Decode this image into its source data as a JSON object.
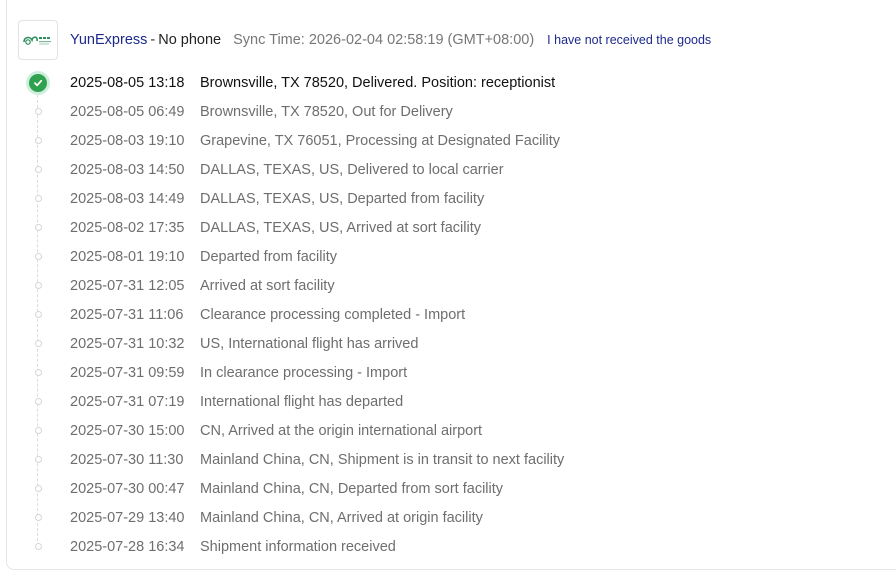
{
  "header": {
    "carrier_name": "YunExpress",
    "separator": "-",
    "phone": "No phone",
    "sync_time": "Sync Time: 2026-02-04 02:58:19 (GMT+08:00)",
    "not_received_link": "I have not received the goods",
    "logo_icon": "yunexpress-logo-icon",
    "accent_color": "#1d2a8c"
  },
  "events": [
    {
      "time": "2025-08-05 13:18",
      "description": "Brownsville, TX 78520, Delivered. Position: receptionist",
      "status": "delivered"
    },
    {
      "time": "2025-08-05 06:49",
      "description": "Brownsville, TX 78520, Out for Delivery"
    },
    {
      "time": "2025-08-03 19:10",
      "description": "Grapevine, TX 76051, Processing at Designated Facility"
    },
    {
      "time": "2025-08-03 14:50",
      "description": "DALLAS, TEXAS, US, Delivered to local carrier"
    },
    {
      "time": "2025-08-03 14:49",
      "description": "DALLAS, TEXAS, US, Departed from facility"
    },
    {
      "time": "2025-08-02 17:35",
      "description": "DALLAS, TEXAS, US, Arrived at sort facility"
    },
    {
      "time": "2025-08-01 19:10",
      "description": "Departed from facility"
    },
    {
      "time": "2025-07-31 12:05",
      "description": "Arrived at sort facility"
    },
    {
      "time": "2025-07-31 11:06",
      "description": "Clearance processing completed - Import"
    },
    {
      "time": "2025-07-31 10:32",
      "description": "US, International flight has arrived"
    },
    {
      "time": "2025-07-31 09:59",
      "description": "In clearance processing - Import"
    },
    {
      "time": "2025-07-31 07:19",
      "description": "International flight has departed"
    },
    {
      "time": "2025-07-30 15:00",
      "description": "CN, Arrived at the origin international airport"
    },
    {
      "time": "2025-07-30 11:30",
      "description": "Mainland China, CN, Shipment is in transit to next facility"
    },
    {
      "time": "2025-07-30 00:47",
      "description": "Mainland China, CN, Departed from sort facility"
    },
    {
      "time": "2025-07-29 13:40",
      "description": "Mainland China, CN, Arrived at origin facility"
    },
    {
      "time": "2025-07-28 16:34",
      "description": "Shipment information received"
    }
  ],
  "status_colors": {
    "delivered": "#30a14e",
    "pending_dot": "#d6d6d6"
  }
}
